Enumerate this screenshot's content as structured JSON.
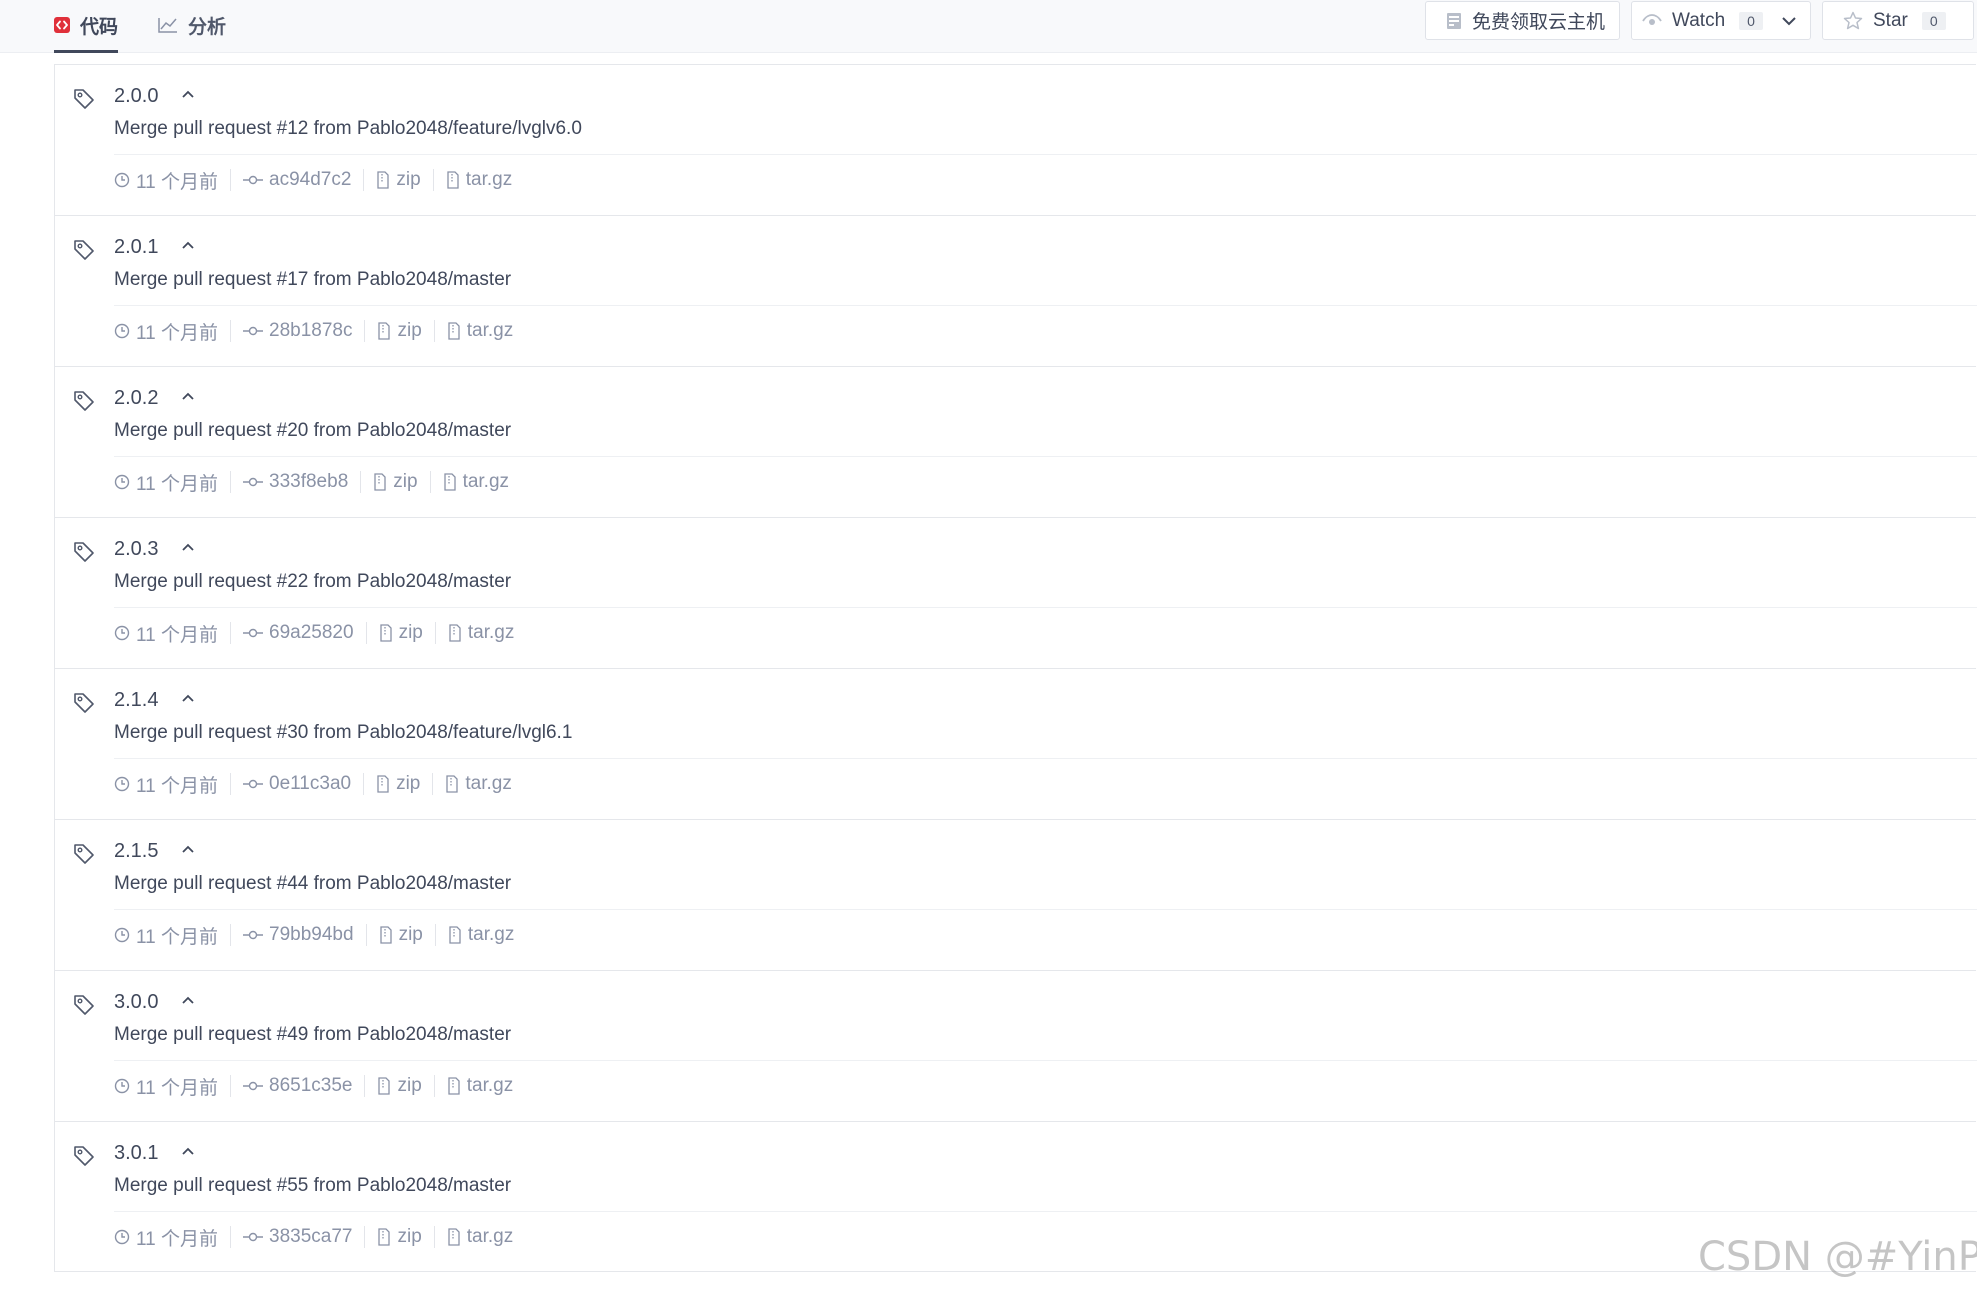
{
  "colors": {
    "text": "#40485b",
    "muted": "#8a92a6",
    "code_icon": "#e0303a",
    "border": "#e5e7eb"
  },
  "nav": {
    "tabs": [
      {
        "label": "代码",
        "icon": "code-icon",
        "active": true
      },
      {
        "label": "分析",
        "icon": "chart-icon",
        "active": false
      }
    ]
  },
  "actions": {
    "cloud_label": "免费领取云主机",
    "watch_label": "Watch",
    "watch_count": "0",
    "star_label": "Star",
    "star_count": "0"
  },
  "tags": [
    {
      "version": "2.0.0",
      "message": "Merge pull request #12 from Pablo2048/feature/lvglv6.0",
      "time": "11 个月前",
      "commit": "ac94d7c2",
      "zip": "zip",
      "targz": "tar.gz"
    },
    {
      "version": "2.0.1",
      "message": "Merge pull request #17 from Pablo2048/master",
      "time": "11 个月前",
      "commit": "28b1878c",
      "zip": "zip",
      "targz": "tar.gz"
    },
    {
      "version": "2.0.2",
      "message": "Merge pull request #20 from Pablo2048/master",
      "time": "11 个月前",
      "commit": "333f8eb8",
      "zip": "zip",
      "targz": "tar.gz"
    },
    {
      "version": "2.0.3",
      "message": "Merge pull request #22 from Pablo2048/master",
      "time": "11 个月前",
      "commit": "69a25820",
      "zip": "zip",
      "targz": "tar.gz"
    },
    {
      "version": "2.1.4",
      "message": "Merge pull request #30 from Pablo2048/feature/lvgl6.1",
      "time": "11 个月前",
      "commit": "0e11c3a0",
      "zip": "zip",
      "targz": "tar.gz"
    },
    {
      "version": "2.1.5",
      "message": "Merge pull request #44 from Pablo2048/master",
      "time": "11 个月前",
      "commit": "79bb94bd",
      "zip": "zip",
      "targz": "tar.gz"
    },
    {
      "version": "3.0.0",
      "message": "Merge pull request #49 from Pablo2048/master",
      "time": "11 个月前",
      "commit": "8651c35e",
      "zip": "zip",
      "targz": "tar.gz"
    },
    {
      "version": "3.0.1",
      "message": "Merge pull request #55 from Pablo2048/master",
      "time": "11 个月前",
      "commit": "3835ca77",
      "zip": "zip",
      "targz": "tar.gz"
    }
  ],
  "watermark": "CSDN @#YinPJ#"
}
